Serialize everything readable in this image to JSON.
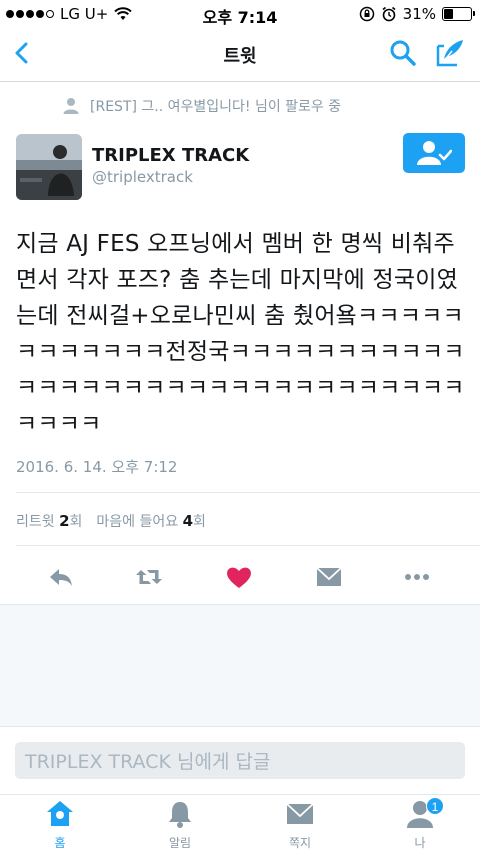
{
  "status_bar": {
    "carrier": "LG U+",
    "time": "오후 7:14",
    "battery_percent": "31%",
    "battery_level": 0.31,
    "icons": [
      "signal-dots",
      "wifi-icon",
      "rotation-lock-icon",
      "alarm-icon",
      "battery-icon"
    ]
  },
  "nav": {
    "title": "트윗",
    "icons": [
      "back-chevron-icon",
      "search-icon",
      "compose-icon"
    ]
  },
  "social_context": {
    "text": "[REST] 그.. 여우별입니다! 님이 팔로우 중",
    "icon": "person-icon"
  },
  "author": {
    "display_name": "TRIPLEX TRACK",
    "screen_name": "@triplextrack",
    "follow_icon": "following-person-check-icon"
  },
  "tweet": {
    "text": "지금 AJ FES 오프닝에서 멤버 한 명씩 비춰주면서 각자 포즈? 춤 추는데 마지막에 정국이였는데 전씨걸+오로나민씨 춤 췄어욬ㅋㅋㅋㅋㅋㅋㅋㅋㅋㅋㅋㅋ전정국ㅋㅋㅋㅋㅋㅋㅋㅋㅋㅋㅋㅋㅋㅋㅋㅋㅋㅋㅋㅋㅋㅋㅋㅋㅋㅋㅋㅋㅋㅋㅋㅋㅋㅋㅋㅋ",
    "timestamp": "2016. 6. 14. 오후 7:12"
  },
  "stats": {
    "retweet_label": "리트윗",
    "retweet_count": "2",
    "retweet_unit": "회",
    "like_label": "마음에 들어요",
    "like_count": "4",
    "like_unit": "회"
  },
  "actions": {
    "icons": [
      "reply-icon",
      "retweet-icon",
      "heart-icon",
      "direct-message-icon",
      "more-icon"
    ],
    "colors": {
      "heart": "#e0245e",
      "default": "#8899a6"
    }
  },
  "reply": {
    "placeholder": "TRIPLEX TRACK 님에게 답글"
  },
  "tabs": [
    {
      "label": "홈",
      "icon": "home-icon",
      "active": true
    },
    {
      "label": "알림",
      "icon": "bell-icon",
      "active": false
    },
    {
      "label": "쪽지",
      "icon": "envelope-icon",
      "active": false
    },
    {
      "label": "나",
      "icon": "person-icon",
      "active": false,
      "badge": "1"
    }
  ],
  "colors": {
    "accent": "#1da1f2",
    "muted": "#8899a6",
    "text": "#14171a"
  }
}
